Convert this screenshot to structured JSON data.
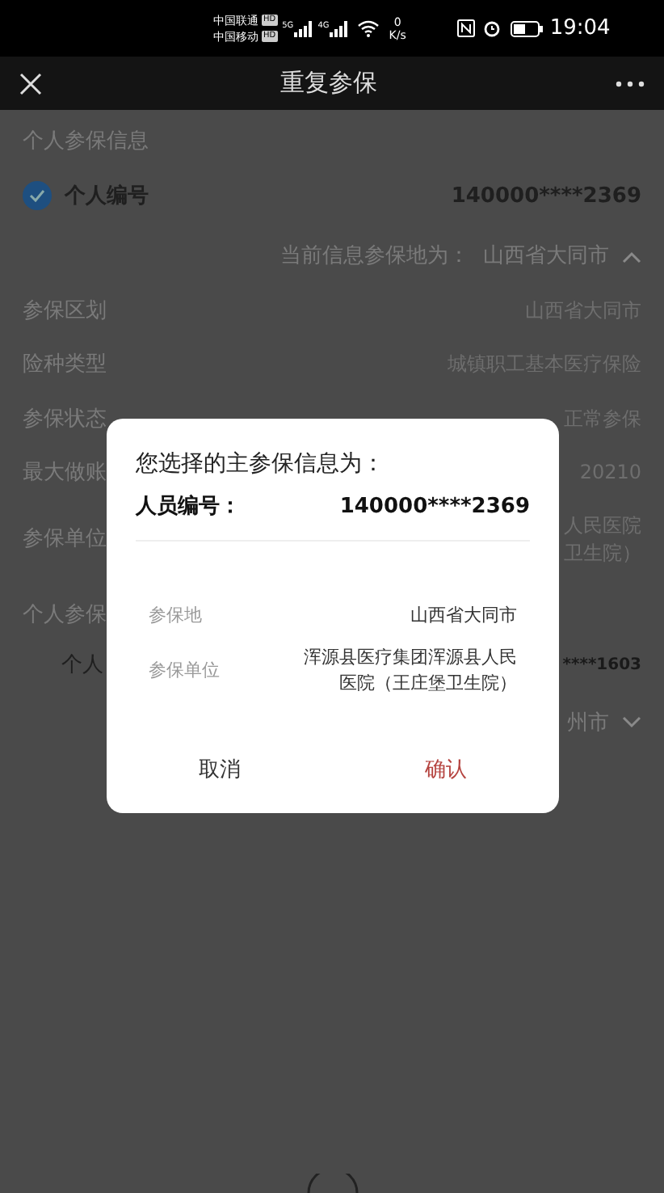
{
  "status_bar": {
    "carriers": [
      "中国联通",
      "中国移动"
    ],
    "hd_badges": [
      "HD",
      "HD"
    ],
    "signal_labels": [
      "5G",
      "4G"
    ],
    "speed_value": "0",
    "speed_unit": "K/s",
    "time": "19:04"
  },
  "header": {
    "title": "重复参保"
  },
  "section_1": {
    "title": "个人参保信息",
    "id_label": "个人编号",
    "id_value": "140000****2369",
    "checked": true,
    "current_location": "当前信息参保地为：  山西省大同市",
    "expanded": true,
    "rows": [
      {
        "label": "参保区划",
        "value": [
          "山西省大同市"
        ]
      },
      {
        "label": "险种类型",
        "value": [
          "城镇职工基本医疗保险"
        ]
      },
      {
        "label": "参保状态",
        "value": [
          "正常参保"
        ]
      },
      {
        "label": "最大做账",
        "value": [
          "20210"
        ]
      },
      {
        "label": "参保单位",
        "value": [
          "人民医院",
          "卫生院）"
        ]
      }
    ]
  },
  "section_2": {
    "title": "个人参保",
    "id_label": "个人",
    "id_value": "****1603",
    "current_location": "州市",
    "expanded": false
  },
  "dialog": {
    "title": "您选择的主参保信息为：",
    "id_label": "人员编号：",
    "id_value": "140000****2369",
    "rows": [
      {
        "label": "参保地",
        "value": "山西省大同市"
      },
      {
        "label": "参保单位",
        "value": "浑源县医疗集团浑源县人民医院（王庄堡卫生院）"
      }
    ],
    "buttons": [
      {
        "label": "取消",
        "kind": "cancel"
      },
      {
        "label": "确认",
        "kind": "confirm"
      }
    ]
  }
}
